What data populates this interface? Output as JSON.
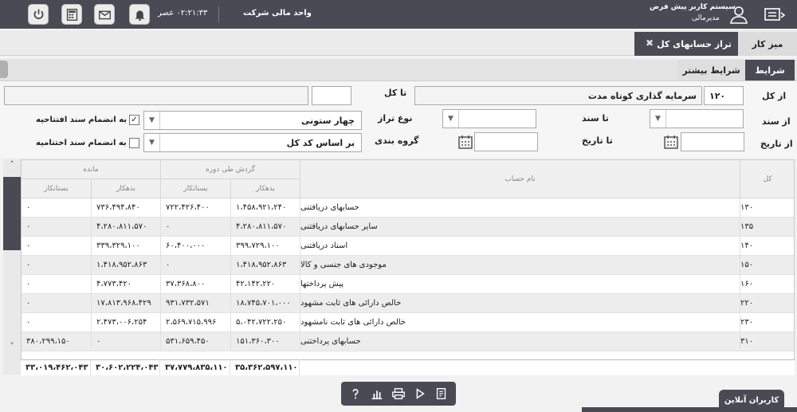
{
  "header": {
    "app_user_title": "سیستم کاربر پیش فرض",
    "user_role": "مدیرمالی",
    "unit": "واحد مالی شرکت",
    "clock": "۰۲:۲۱:۳۳ عصر"
  },
  "tabs": [
    {
      "label": "میز کار"
    },
    {
      "label": "تراز حسابهای کل"
    }
  ],
  "subtabs": [
    {
      "label": "شرایط"
    },
    {
      "label": "شرایط بیشتر"
    }
  ],
  "filters": {
    "from_kol_label": "از کل",
    "from_kol_code": "۱۲۰",
    "from_kol_name": "سرمایه گذاری کوتاه مدت",
    "to_kol_label": "تا کل",
    "to_kol_code": "",
    "to_kol_name": "",
    "from_sanad_label": "از سند",
    "from_sanad_value": "",
    "to_sanad_label": "تا سند",
    "to_sanad_value": "",
    "balance_type_label": "نوع تراز",
    "balance_type_value": "چهار ستونی",
    "grouping_label": "گروه بندی",
    "grouping_value": "بر اساس کد کل",
    "from_date_label": "از تاریخ",
    "from_date_value": "",
    "to_date_label": "تا تاریخ",
    "to_date_value": "",
    "opening_doc_label": "به انضمام سند افتتاحیه",
    "opening_doc_checked": "✓",
    "closing_doc_label": "به انضمام سند اختتامیه",
    "closing_doc_checked": ""
  },
  "table": {
    "col_kol": "کل",
    "col_name": "نام حساب",
    "group_turnover": "گردش طی دوره",
    "group_balance": "مانده",
    "col_debit": "بدهکار",
    "col_credit": "بستانکار",
    "rows": [
      {
        "code": "۱۳۰",
        "name": "حسابهای دریافتنی",
        "t_debit": "۱،۴۵۸،۹۲۱،۲۴۰",
        "t_credit": "۷۲۲،۴۲۶،۴۰۰",
        "b_debit": "۷۳۶،۴۹۴،۸۴۰",
        "b_credit": "۰"
      },
      {
        "code": "۱۳۵",
        "name": "سایر حسابهای دریافتنی",
        "t_debit": "۴،۲۸۰،۸۱۱،۵۷۰",
        "t_credit": "۰",
        "b_debit": "۴،۲۸۰،۸۱۱،۵۷۰",
        "b_credit": "۰"
      },
      {
        "code": "۱۴۰",
        "name": "اسناد دریافتنی",
        "t_debit": "۳۹۹،۷۲۹،۱۰۰",
        "t_credit": "۶۰،۴۰۰،۰۰۰",
        "b_debit": "۳۳۹،۳۲۹،۱۰۰",
        "b_credit": "۰"
      },
      {
        "code": "۱۵۰",
        "name": "موجودی های جنسی و کالا",
        "t_debit": "۱،۴۱۸،۹۵۲،۸۶۳",
        "t_credit": "۰",
        "b_debit": "۱،۴۱۸،۹۵۲،۸۶۳",
        "b_credit": "۰"
      },
      {
        "code": "۱۶۰",
        "name": "پیش پرداختها",
        "t_debit": "۴۲،۱۴۲،۲۲۰",
        "t_credit": "۳۷،۳۶۸،۸۰۰",
        "b_debit": "۴،۷۷۳،۴۲۰",
        "b_credit": "۰"
      },
      {
        "code": "۲۲۰",
        "name": "خالص دارائی های ثابت مشهود",
        "t_debit": "۱۸،۷۴۵،۷۰۱،۰۰۰",
        "t_credit": "۹۳۱،۷۳۲،۵۷۱",
        "b_debit": "۱۷،۸۱۳،۹۶۸،۴۲۹",
        "b_credit": "۰"
      },
      {
        "code": "۲۳۰",
        "name": "خالص دارائی های ثابت نامشهود",
        "t_debit": "۵،۰۴۲،۷۲۲،۲۵۰",
        "t_credit": "۲،۵۶۹،۷۱۵،۹۹۶",
        "b_debit": "۲،۴۷۳،۰۰۶،۲۵۴",
        "b_credit": "۰"
      },
      {
        "code": "۳۱۰",
        "name": "حسابهای پرداختنی",
        "t_debit": "۱۵۱،۳۶۰،۳۰۰",
        "t_credit": "۵۳۱،۶۵۹،۴۵۰",
        "b_debit": "۰",
        "b_credit": "۳۸۰،۲۹۹،۱۵۰"
      }
    ],
    "totals": {
      "t_debit": "۳۵،۳۶۲،۵۹۷،۱۱۰",
      "t_credit": "۳۷،۷۷۹،۸۳۵،۱۱۰",
      "b_debit": "۳۰،۶۰۲،۲۲۴،۰۴۳",
      "b_credit": "۳۳،۰۱۹،۴۶۲،۰۴۳"
    }
  },
  "footer": {
    "online_users": "کاربران آنلاین"
  },
  "colors": {
    "header_bg": "#4a4a55",
    "row_alt": "#ededed"
  }
}
